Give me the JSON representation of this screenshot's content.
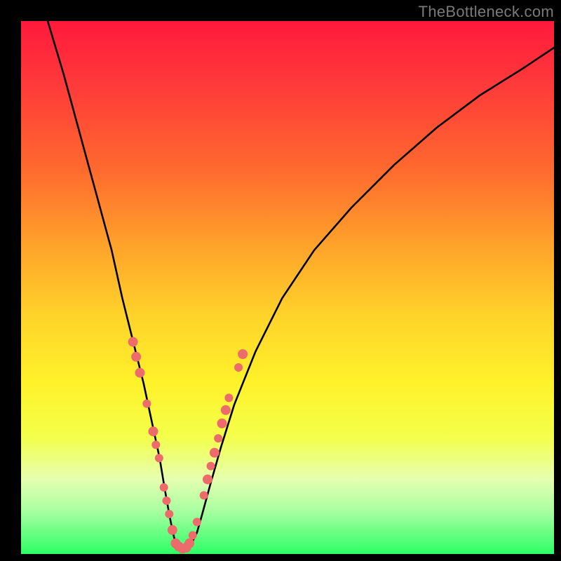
{
  "watermark": "TheBottleneck.com",
  "chart_data": {
    "type": "line",
    "title": "",
    "xlabel": "",
    "ylabel": "",
    "xlim": [
      0,
      100
    ],
    "ylim": [
      0,
      100
    ],
    "grid": false,
    "series": [
      {
        "name": "bottleneck-curve",
        "x": [
          5,
          8,
          11,
          14,
          17,
          19,
          21,
          23,
          24.5,
          26,
          27,
          27.8,
          28.5,
          29,
          30,
          31,
          32,
          33,
          34,
          35.5,
          37.5,
          40,
          44,
          49,
          55,
          62,
          70,
          78,
          86,
          94,
          100
        ],
        "y": [
          100,
          90,
          79,
          68,
          57,
          48,
          40,
          32,
          25,
          18,
          12,
          7.5,
          4,
          2,
          1,
          1,
          2,
          4,
          7.5,
          13,
          20,
          28,
          38,
          48,
          57,
          65,
          73,
          80,
          86,
          91,
          95
        ]
      }
    ],
    "markers": [
      {
        "x": 21.0,
        "y": 39.8,
        "r": 7
      },
      {
        "x": 21.6,
        "y": 37.0,
        "r": 7
      },
      {
        "x": 22.3,
        "y": 34.0,
        "r": 7
      },
      {
        "x": 23.6,
        "y": 28.2,
        "r": 6
      },
      {
        "x": 24.8,
        "y": 23.0,
        "r": 7
      },
      {
        "x": 25.3,
        "y": 20.5,
        "r": 6
      },
      {
        "x": 25.9,
        "y": 18.0,
        "r": 6
      },
      {
        "x": 26.8,
        "y": 12.5,
        "r": 6
      },
      {
        "x": 27.3,
        "y": 10.0,
        "r": 6
      },
      {
        "x": 27.8,
        "y": 7.5,
        "r": 6
      },
      {
        "x": 28.4,
        "y": 4.5,
        "r": 7
      },
      {
        "x": 29.0,
        "y": 2.0,
        "r": 7
      },
      {
        "x": 29.6,
        "y": 1.4,
        "r": 7
      },
      {
        "x": 30.3,
        "y": 1.0,
        "r": 7
      },
      {
        "x": 31.0,
        "y": 1.2,
        "r": 7
      },
      {
        "x": 31.6,
        "y": 2.0,
        "r": 7
      },
      {
        "x": 32.2,
        "y": 3.5,
        "r": 6
      },
      {
        "x": 33.0,
        "y": 6.0,
        "r": 6
      },
      {
        "x": 34.3,
        "y": 11.0,
        "r": 6
      },
      {
        "x": 35.0,
        "y": 14.0,
        "r": 7
      },
      {
        "x": 35.6,
        "y": 16.5,
        "r": 6
      },
      {
        "x": 36.3,
        "y": 19.0,
        "r": 7
      },
      {
        "x": 37.0,
        "y": 21.7,
        "r": 6
      },
      {
        "x": 37.7,
        "y": 24.5,
        "r": 7
      },
      {
        "x": 38.4,
        "y": 27.0,
        "r": 7
      },
      {
        "x": 39.0,
        "y": 29.3,
        "r": 6
      },
      {
        "x": 40.8,
        "y": 35.0,
        "r": 6
      },
      {
        "x": 41.6,
        "y": 37.5,
        "r": 7
      }
    ],
    "marker_color": "#ed6b6b",
    "curve_color": "#000000"
  }
}
